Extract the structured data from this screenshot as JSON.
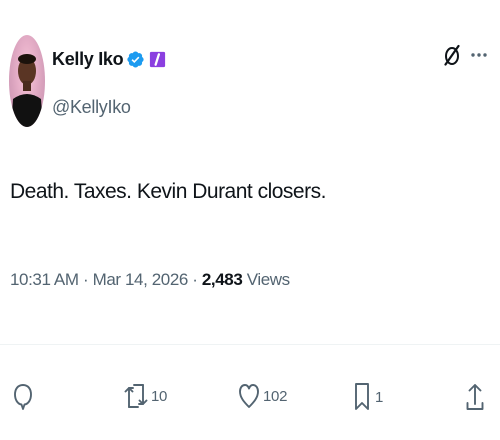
{
  "author": {
    "display_name": "Kelly Iko",
    "handle": "@KellyIko",
    "verified": true,
    "verified_color": "#1d9bf0",
    "affiliate_badge_color": "#8b3fe0"
  },
  "tweet": {
    "text": "Death. Taxes. Kevin Durant closers."
  },
  "meta": {
    "time": "10:31 AM",
    "separator_1": " · ",
    "date": "Mar 14, 2026",
    "separator_2": " · ",
    "views_count": "2,483",
    "views_label": " Views"
  },
  "actions": {
    "reply_count": "",
    "retweet_count": "10",
    "like_count": "102",
    "bookmark_count": "1"
  },
  "icons": {
    "grok": "grok-icon",
    "more": "more-icon",
    "reply": "reply-icon",
    "retweet": "retweet-icon",
    "like": "like-icon",
    "bookmark": "bookmark-icon",
    "share": "share-icon"
  }
}
